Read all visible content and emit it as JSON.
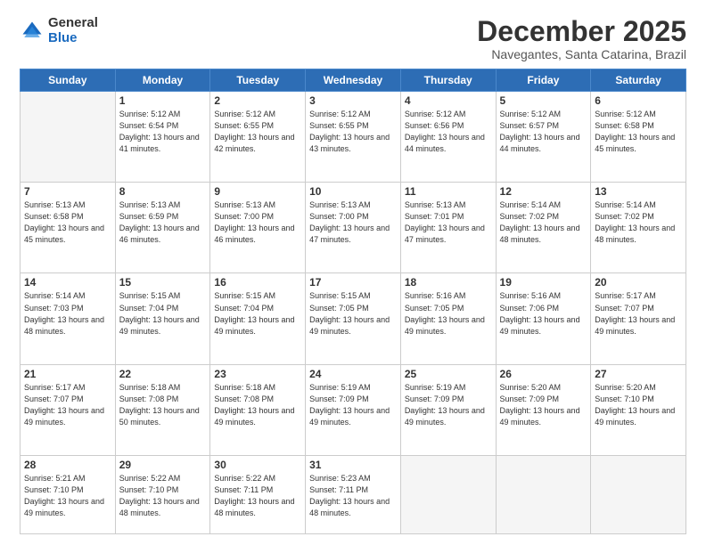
{
  "logo": {
    "general": "General",
    "blue": "Blue"
  },
  "header": {
    "month": "December 2025",
    "location": "Navegantes, Santa Catarina, Brazil"
  },
  "weekdays": [
    "Sunday",
    "Monday",
    "Tuesday",
    "Wednesday",
    "Thursday",
    "Friday",
    "Saturday"
  ],
  "weeks": [
    [
      {
        "day": "",
        "sunrise": "",
        "sunset": "",
        "daylight": ""
      },
      {
        "day": "1",
        "sunrise": "Sunrise: 5:12 AM",
        "sunset": "Sunset: 6:54 PM",
        "daylight": "Daylight: 13 hours and 41 minutes."
      },
      {
        "day": "2",
        "sunrise": "Sunrise: 5:12 AM",
        "sunset": "Sunset: 6:55 PM",
        "daylight": "Daylight: 13 hours and 42 minutes."
      },
      {
        "day": "3",
        "sunrise": "Sunrise: 5:12 AM",
        "sunset": "Sunset: 6:55 PM",
        "daylight": "Daylight: 13 hours and 43 minutes."
      },
      {
        "day": "4",
        "sunrise": "Sunrise: 5:12 AM",
        "sunset": "Sunset: 6:56 PM",
        "daylight": "Daylight: 13 hours and 44 minutes."
      },
      {
        "day": "5",
        "sunrise": "Sunrise: 5:12 AM",
        "sunset": "Sunset: 6:57 PM",
        "daylight": "Daylight: 13 hours and 44 minutes."
      },
      {
        "day": "6",
        "sunrise": "Sunrise: 5:12 AM",
        "sunset": "Sunset: 6:58 PM",
        "daylight": "Daylight: 13 hours and 45 minutes."
      }
    ],
    [
      {
        "day": "7",
        "sunrise": "Sunrise: 5:13 AM",
        "sunset": "Sunset: 6:58 PM",
        "daylight": "Daylight: 13 hours and 45 minutes."
      },
      {
        "day": "8",
        "sunrise": "Sunrise: 5:13 AM",
        "sunset": "Sunset: 6:59 PM",
        "daylight": "Daylight: 13 hours and 46 minutes."
      },
      {
        "day": "9",
        "sunrise": "Sunrise: 5:13 AM",
        "sunset": "Sunset: 7:00 PM",
        "daylight": "Daylight: 13 hours and 46 minutes."
      },
      {
        "day": "10",
        "sunrise": "Sunrise: 5:13 AM",
        "sunset": "Sunset: 7:00 PM",
        "daylight": "Daylight: 13 hours and 47 minutes."
      },
      {
        "day": "11",
        "sunrise": "Sunrise: 5:13 AM",
        "sunset": "Sunset: 7:01 PM",
        "daylight": "Daylight: 13 hours and 47 minutes."
      },
      {
        "day": "12",
        "sunrise": "Sunrise: 5:14 AM",
        "sunset": "Sunset: 7:02 PM",
        "daylight": "Daylight: 13 hours and 48 minutes."
      },
      {
        "day": "13",
        "sunrise": "Sunrise: 5:14 AM",
        "sunset": "Sunset: 7:02 PM",
        "daylight": "Daylight: 13 hours and 48 minutes."
      }
    ],
    [
      {
        "day": "14",
        "sunrise": "Sunrise: 5:14 AM",
        "sunset": "Sunset: 7:03 PM",
        "daylight": "Daylight: 13 hours and 48 minutes."
      },
      {
        "day": "15",
        "sunrise": "Sunrise: 5:15 AM",
        "sunset": "Sunset: 7:04 PM",
        "daylight": "Daylight: 13 hours and 49 minutes."
      },
      {
        "day": "16",
        "sunrise": "Sunrise: 5:15 AM",
        "sunset": "Sunset: 7:04 PM",
        "daylight": "Daylight: 13 hours and 49 minutes."
      },
      {
        "day": "17",
        "sunrise": "Sunrise: 5:15 AM",
        "sunset": "Sunset: 7:05 PM",
        "daylight": "Daylight: 13 hours and 49 minutes."
      },
      {
        "day": "18",
        "sunrise": "Sunrise: 5:16 AM",
        "sunset": "Sunset: 7:05 PM",
        "daylight": "Daylight: 13 hours and 49 minutes."
      },
      {
        "day": "19",
        "sunrise": "Sunrise: 5:16 AM",
        "sunset": "Sunset: 7:06 PM",
        "daylight": "Daylight: 13 hours and 49 minutes."
      },
      {
        "day": "20",
        "sunrise": "Sunrise: 5:17 AM",
        "sunset": "Sunset: 7:07 PM",
        "daylight": "Daylight: 13 hours and 49 minutes."
      }
    ],
    [
      {
        "day": "21",
        "sunrise": "Sunrise: 5:17 AM",
        "sunset": "Sunset: 7:07 PM",
        "daylight": "Daylight: 13 hours and 49 minutes."
      },
      {
        "day": "22",
        "sunrise": "Sunrise: 5:18 AM",
        "sunset": "Sunset: 7:08 PM",
        "daylight": "Daylight: 13 hours and 50 minutes."
      },
      {
        "day": "23",
        "sunrise": "Sunrise: 5:18 AM",
        "sunset": "Sunset: 7:08 PM",
        "daylight": "Daylight: 13 hours and 49 minutes."
      },
      {
        "day": "24",
        "sunrise": "Sunrise: 5:19 AM",
        "sunset": "Sunset: 7:09 PM",
        "daylight": "Daylight: 13 hours and 49 minutes."
      },
      {
        "day": "25",
        "sunrise": "Sunrise: 5:19 AM",
        "sunset": "Sunset: 7:09 PM",
        "daylight": "Daylight: 13 hours and 49 minutes."
      },
      {
        "day": "26",
        "sunrise": "Sunrise: 5:20 AM",
        "sunset": "Sunset: 7:09 PM",
        "daylight": "Daylight: 13 hours and 49 minutes."
      },
      {
        "day": "27",
        "sunrise": "Sunrise: 5:20 AM",
        "sunset": "Sunset: 7:10 PM",
        "daylight": "Daylight: 13 hours and 49 minutes."
      }
    ],
    [
      {
        "day": "28",
        "sunrise": "Sunrise: 5:21 AM",
        "sunset": "Sunset: 7:10 PM",
        "daylight": "Daylight: 13 hours and 49 minutes."
      },
      {
        "day": "29",
        "sunrise": "Sunrise: 5:22 AM",
        "sunset": "Sunset: 7:10 PM",
        "daylight": "Daylight: 13 hours and 48 minutes."
      },
      {
        "day": "30",
        "sunrise": "Sunrise: 5:22 AM",
        "sunset": "Sunset: 7:11 PM",
        "daylight": "Daylight: 13 hours and 48 minutes."
      },
      {
        "day": "31",
        "sunrise": "Sunrise: 5:23 AM",
        "sunset": "Sunset: 7:11 PM",
        "daylight": "Daylight: 13 hours and 48 minutes."
      },
      {
        "day": "",
        "sunrise": "",
        "sunset": "",
        "daylight": ""
      },
      {
        "day": "",
        "sunrise": "",
        "sunset": "",
        "daylight": ""
      },
      {
        "day": "",
        "sunrise": "",
        "sunset": "",
        "daylight": ""
      }
    ]
  ]
}
